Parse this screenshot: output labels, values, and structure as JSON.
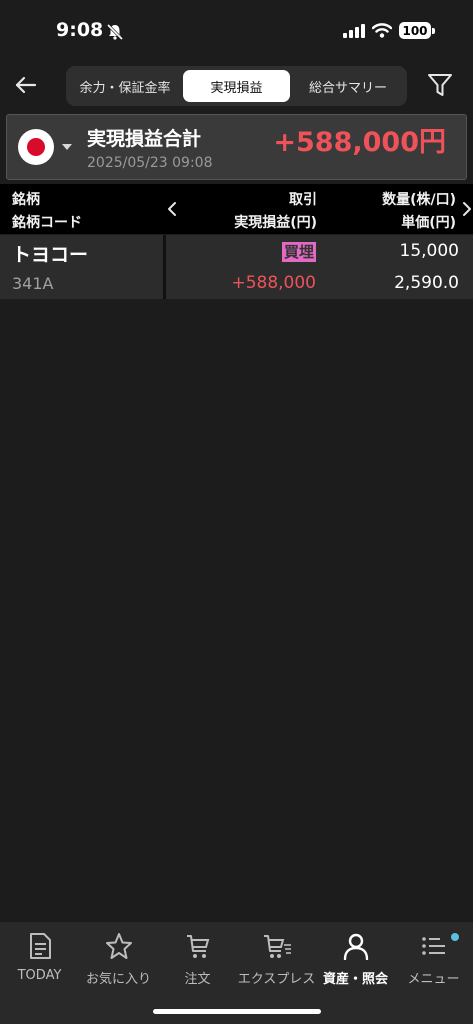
{
  "status": {
    "time": "9:08",
    "battery": "100"
  },
  "tabs": [
    "余力・保証金率",
    "実現損益",
    "総合サマリー"
  ],
  "summary": {
    "title": "実現損益合計",
    "date": "2025/05/23 09:08",
    "value": "+588,000円"
  },
  "table": {
    "headers": {
      "col1_line1": "銘柄",
      "col1_line2": "銘柄コード",
      "col2_line1": "取引",
      "col2_line2": "実現損益(円)",
      "col3_line1": "数量(株/口)",
      "col3_line2": "単価(円)"
    },
    "rows": [
      {
        "name": "トヨコー",
        "code": "341A",
        "trade": "買埋",
        "pl": "+588,000",
        "qty": "15,000",
        "price": "2,590.0"
      }
    ]
  },
  "bottom_nav": [
    "TODAY",
    "お気に入り",
    "注文",
    "エクスプレス",
    "資産・照会",
    "メニュー"
  ],
  "colors": {
    "profit_red": "#f0525a",
    "trade_badge": "#e36ac4",
    "background": "#1c1c1c"
  },
  "icons": [
    "bell-slash-icon",
    "signal-icon",
    "wifi-icon",
    "battery-icon",
    "back-arrow-icon",
    "filter-icon",
    "japan-flag-icon",
    "chevron-left-icon",
    "chevron-right-icon",
    "document-icon",
    "star-icon",
    "cart-icon",
    "express-cart-icon",
    "person-icon",
    "menu-list-icon"
  ]
}
